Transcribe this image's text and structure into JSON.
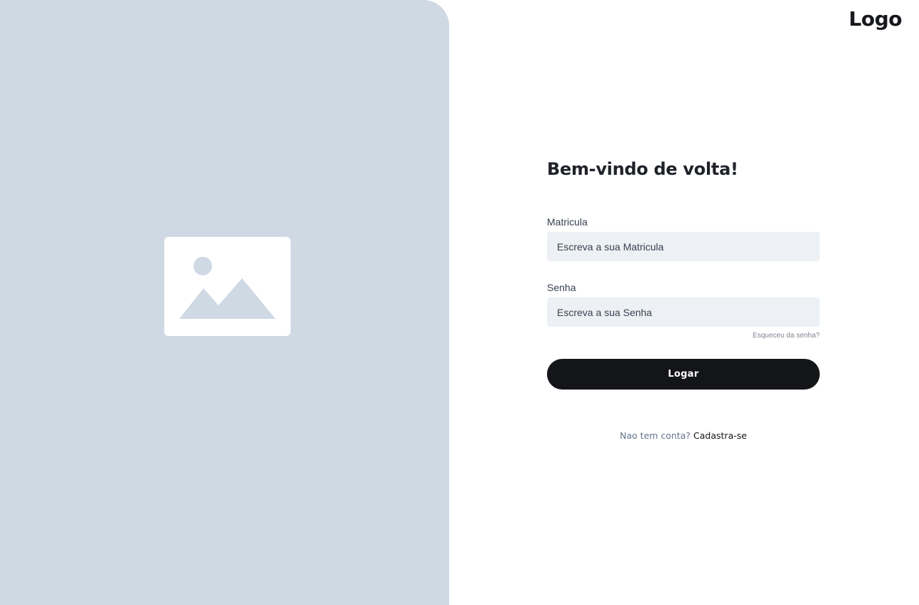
{
  "brand": {
    "logo_text": "Logo"
  },
  "hero": {
    "image_icon": "image-placeholder-icon"
  },
  "login": {
    "title": "Bem-vindo de volta!",
    "matricula": {
      "label": "Matricula",
      "placeholder": "Escreva a sua Matricula",
      "value": ""
    },
    "senha": {
      "label": "Senha",
      "placeholder": "Escreva a sua Senha",
      "value": ""
    },
    "forgot_password": "Esqueceu da senha?",
    "submit_label": "Logar",
    "signup_prompt": "Nao tem conta?",
    "signup_link": "Cadastra-se"
  },
  "colors": {
    "panel_background": "#cfd9e4",
    "input_background": "#edf1f5",
    "button_background": "#141518"
  }
}
